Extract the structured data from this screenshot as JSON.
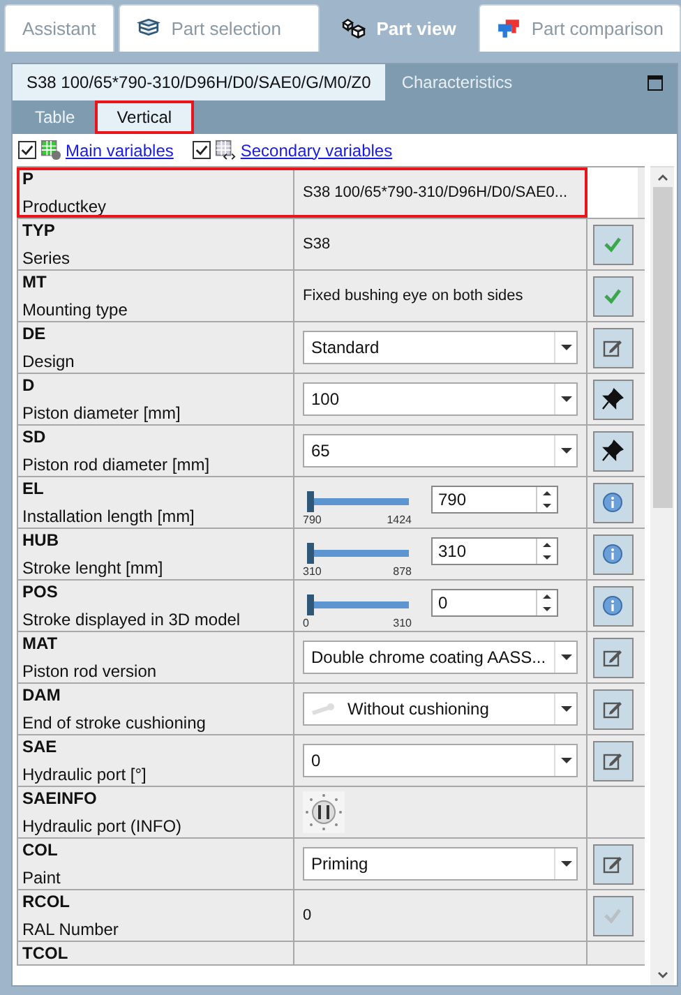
{
  "tabs": [
    {
      "label": "Assistant",
      "selected": false
    },
    {
      "label": "Part selection",
      "selected": false
    },
    {
      "label": "Part view",
      "selected": true
    },
    {
      "label": "Part comparison",
      "selected": false
    }
  ],
  "panel": {
    "title": "S38 100/65*790-310/D96H/D0/SAE0/G/M0/Z0",
    "second_tab": "Characteristics"
  },
  "subtabs": [
    {
      "label": "Table",
      "selected": false,
      "highlighted": false
    },
    {
      "label": "Vertical",
      "selected": true,
      "highlighted": true
    }
  ],
  "filters": [
    {
      "label": "Main variables",
      "checked": true
    },
    {
      "label": "Secondary variables",
      "checked": true
    }
  ],
  "rows": [
    {
      "code": "P",
      "name": "Productkey",
      "kind": "text",
      "value": "S38 100/65*790-310/D96H/D0/SAE0...",
      "highlighted": true
    },
    {
      "code": "TYP",
      "name": "Series",
      "kind": "text",
      "value": "S38",
      "button": {
        "kind": "check",
        "disabled": false
      },
      "highlighted": false
    },
    {
      "code": "MT",
      "name": "Mounting type",
      "kind": "text",
      "value": "Fixed bushing eye on both sides",
      "button": {
        "kind": "check",
        "disabled": false
      },
      "highlighted": false
    },
    {
      "code": "DE",
      "name": "Design",
      "kind": "select",
      "value": "Standard",
      "button": {
        "kind": "edit",
        "disabled": false
      },
      "highlighted": false
    },
    {
      "code": "D",
      "name": "Piston diameter [mm]",
      "kind": "select",
      "value": "100",
      "button": {
        "kind": "pin",
        "disabled": false
      },
      "highlighted": false
    },
    {
      "code": "SD",
      "name": "Piston rod diameter [mm]",
      "kind": "select",
      "value": "65",
      "button": {
        "kind": "pin",
        "disabled": false
      },
      "highlighted": false
    },
    {
      "code": "EL",
      "name": "Installation length [mm]",
      "kind": "slider",
      "value": "790",
      "min": "790",
      "max": "1424",
      "level": 0,
      "button": {
        "kind": "info",
        "disabled": false
      },
      "highlighted": false
    },
    {
      "code": "HUB",
      "name": "Stroke lenght [mm]",
      "kind": "slider",
      "value": "310",
      "min": "310",
      "max": "878",
      "level": 0,
      "button": {
        "kind": "info",
        "disabled": false
      },
      "highlighted": false
    },
    {
      "code": "POS",
      "name": "Stroke displayed in 3D model",
      "kind": "slider",
      "value": "0",
      "min": "0",
      "max": "310",
      "level": 0,
      "button": {
        "kind": "info",
        "disabled": false
      },
      "highlighted": false
    },
    {
      "code": "MAT",
      "name": "Piston rod version",
      "kind": "select",
      "value": "Double chrome coating AASS...",
      "button": {
        "kind": "edit",
        "disabled": false
      },
      "highlighted": false
    },
    {
      "code": "DAM",
      "name": "End of stroke cushioning",
      "kind": "select-icon",
      "value": "Without cushioning",
      "button": {
        "kind": "edit",
        "disabled": false
      },
      "highlighted": false
    },
    {
      "code": "SAE",
      "name": "Hydraulic port [°]",
      "kind": "select",
      "value": "0",
      "button": {
        "kind": "edit",
        "disabled": false
      },
      "highlighted": false
    },
    {
      "code": "SAEINFO",
      "name": "Hydraulic port (INFO)",
      "kind": "image",
      "highlighted": false
    },
    {
      "code": "COL",
      "name": "Paint",
      "kind": "select",
      "value": "Priming",
      "button": {
        "kind": "edit",
        "disabled": false
      },
      "highlighted": false
    },
    {
      "code": "RCOL",
      "name": "RAL Number",
      "kind": "text",
      "value": "0",
      "button": {
        "kind": "check",
        "disabled": true
      },
      "highlighted": false
    },
    {
      "code": "TCOL",
      "kind": "partial",
      "highlighted": false
    }
  ]
}
